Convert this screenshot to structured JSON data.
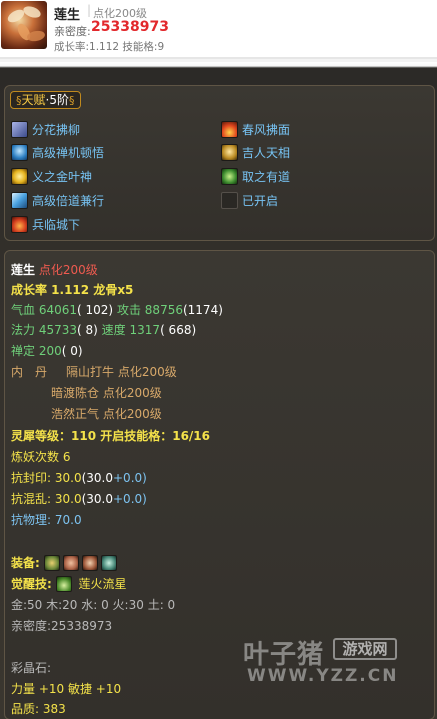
{
  "header": {
    "name": "莲生",
    "separator": "|",
    "level": "点化200级",
    "intimacy_label": "亲密度:",
    "intimacy_value": "25338973",
    "rate_line": "成长率:1.112 技能格:9"
  },
  "talent": {
    "label": "天赋",
    "dot": "·",
    "level": "5阶",
    "skills": [
      {
        "label": "分花拂柳",
        "icon": "flower-swirl-icon",
        "color": "#6b7fb8"
      },
      {
        "label": "春风拂面",
        "icon": "wind-fire-icon",
        "color": "#d9532a"
      },
      {
        "label": "高级禅机顿悟",
        "icon": "meditation-icon",
        "color": "#3c8fc8"
      },
      {
        "label": "吉人天相",
        "icon": "golden-figure-icon",
        "color": "#c39a2a"
      },
      {
        "label": "义之金叶神",
        "icon": "golden-leaf-icon",
        "color": "#e0b12a"
      },
      {
        "label": "取之有道",
        "icon": "green-spirit-icon",
        "color": "#3f8f3a"
      },
      {
        "label": "高级倍道兼行",
        "icon": "swift-travel-icon",
        "color": "#5aa8e0"
      },
      {
        "label": "已开启",
        "icon": "locked-slot-icon",
        "color": "#4a4640"
      },
      {
        "label": "兵临城下",
        "icon": "army-siege-icon",
        "color": "#d0442a"
      }
    ]
  },
  "stats": {
    "name": "莲生",
    "level": "点化200级",
    "growth": "成长率 1.112 龙骨x5",
    "hp_label": "气血",
    "hp_value": "64061",
    "hp_paren": "( 102)",
    "atk_label": "攻击",
    "atk_value": "88756",
    "atk_paren": "(1174)",
    "mp_label": "法力",
    "mp_value": "45733",
    "mp_paren": "( 8)",
    "spd_label": "速度",
    "spd_value": "1317",
    "spd_paren": "( 668)",
    "def_label": "禅定",
    "def_value": "200",
    "def_paren": "( 0)",
    "neidan_label": "内　丹",
    "neidan": [
      "隔山打牛 点化200级",
      "暗渡陈仓 点化200级",
      "浩然正气 点化200级"
    ],
    "spirit": "灵犀等级：110 开启技能格：16/16",
    "refine": "炼妖次数 6",
    "seal_label": "抗封印:",
    "seal_a": "30.0",
    "seal_b": "(30.0",
    "seal_c": "+0.0)",
    "chaos_label": "抗混乱:",
    "chaos_a": "30.0",
    "chaos_b": "(30.0",
    "chaos_c": "+0.0)",
    "phys": "抗物理: 70.0",
    "equip_label": "装备:",
    "equip_icons": [
      {
        "name": "equip-ring-icon",
        "color": "#6e8a3a"
      },
      {
        "name": "equip-claw-icon",
        "color": "#b0664a"
      },
      {
        "name": "equip-fang-icon",
        "color": "#a05a3c"
      },
      {
        "name": "equip-wing-icon",
        "color": "#4a8a7a"
      }
    ],
    "awaken_label": "觉醒技:",
    "awaken_skill": "莲火流星",
    "elements": "金:50 木:20 水: 0 火:30 土: 0",
    "intimacy": "亲密度:25338973",
    "gem_label": "彩晶石:",
    "gem_stats": "力量 +10 敏捷 +10",
    "quality_label": "品质:",
    "quality_value": "383"
  },
  "watermark": {
    "main": "叶子猪",
    "tag": "游戏网",
    "url": "WWW.YZZ.CN"
  }
}
